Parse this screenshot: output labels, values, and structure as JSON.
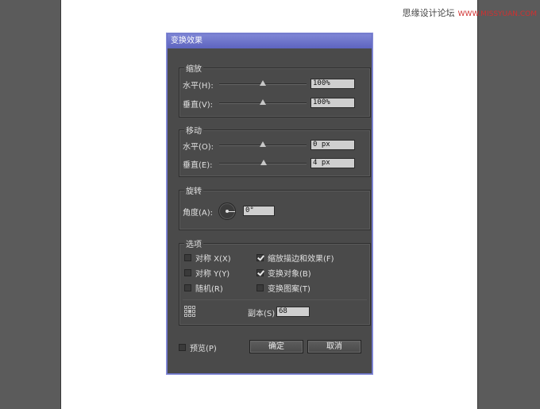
{
  "watermark": {
    "text": "思缘设计论坛",
    "url": "WWW.MISSYUAN.COM"
  },
  "dialog": {
    "title": "变换效果",
    "scale": {
      "title": "缩放",
      "horizontal": {
        "label": "水平(H):",
        "value": "100%",
        "slider_fraction": 0.5
      },
      "vertical": {
        "label": "垂直(V):",
        "value": "100%",
        "slider_fraction": 0.5
      }
    },
    "move": {
      "title": "移动",
      "horizontal": {
        "label": "水平(O):",
        "value": "0 px",
        "slider_fraction": 0.5
      },
      "vertical": {
        "label": "垂直(E):",
        "value": "4 px",
        "slider_fraction": 0.51
      }
    },
    "rotate": {
      "title": "旋转",
      "angle": {
        "label": "角度(A):",
        "value": "0°"
      }
    },
    "options": {
      "title": "选项",
      "reflect_x": {
        "label": "对称 X(X)",
        "checked": false
      },
      "reflect_y": {
        "label": "对称 Y(Y)",
        "checked": false
      },
      "random": {
        "label": "随机(R)",
        "checked": false
      },
      "scale_strokes": {
        "label": "缩放描边和效果(F)",
        "checked": true
      },
      "transform_objects": {
        "label": "变换对象(B)",
        "checked": true
      },
      "transform_patterns": {
        "label": "变换图案(T)",
        "checked": false
      },
      "copies": {
        "label": "副本(S)",
        "value": "68"
      }
    },
    "preview": {
      "label": "预览(P)",
      "checked": false
    },
    "ok_label": "确定",
    "cancel_label": "取消",
    "icons": {
      "reference_point": "reference-point-grid-icon",
      "angle_dial": "angle-dial-icon"
    }
  }
}
